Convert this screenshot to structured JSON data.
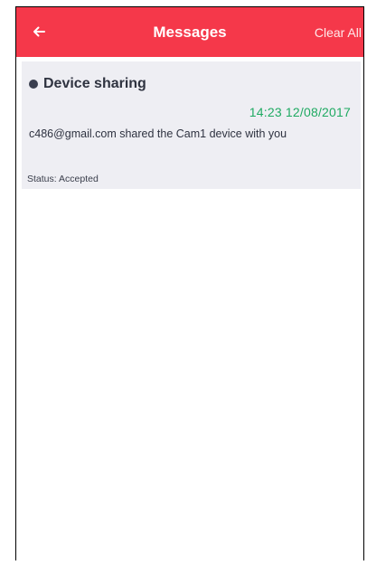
{
  "header": {
    "title": "Messages",
    "clear_all": "Clear All",
    "back_icon": "arrow-left-icon",
    "background_color": "#f5384a"
  },
  "messages": [
    {
      "title": "Device sharing",
      "timestamp": "14:23 12/08/2017",
      "body": "c486@gmail.com shared the Cam1 device with you",
      "status": "Status: Accepted",
      "timestamp_color": "#1faa62"
    }
  ]
}
